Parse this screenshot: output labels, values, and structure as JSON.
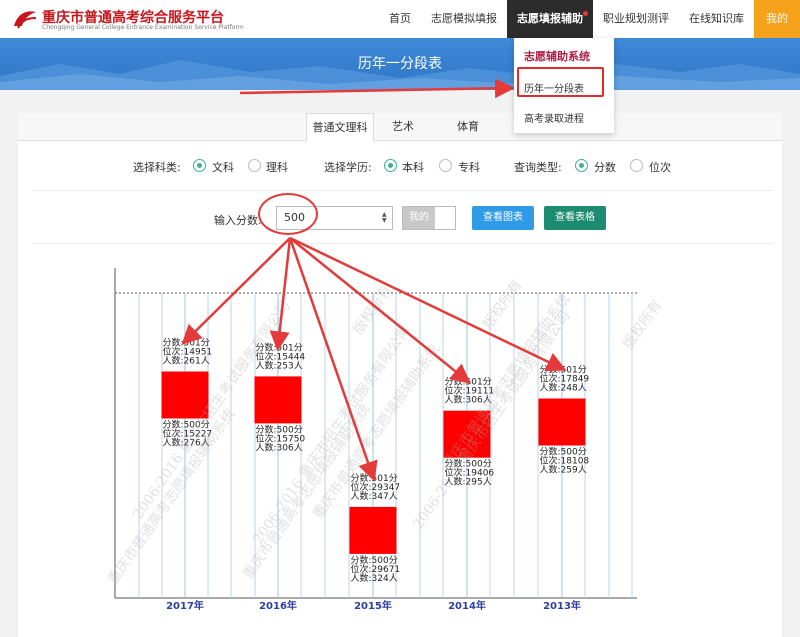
{
  "header": {
    "site_title": "重庆市普通高考综合服务平台",
    "site_subtitle": "Chongqing General College Entrance Examination Service Platform",
    "nav": [
      {
        "label": "首页"
      },
      {
        "label": "志愿模拟填报"
      },
      {
        "label": "志愿填报辅助",
        "active": true
      },
      {
        "label": "职业规划测评"
      },
      {
        "label": "在线知识库"
      },
      {
        "label": "我的"
      }
    ]
  },
  "banner": {
    "title": "历年一分段表"
  },
  "dropdown": {
    "header": "志愿辅助系统",
    "items": [
      {
        "label": "历年一分段表",
        "highlighted": true
      },
      {
        "label": "高考录取进程"
      }
    ]
  },
  "tabs": [
    {
      "label": "普通文理科",
      "active": true
    },
    {
      "label": "艺术"
    },
    {
      "label": "体育"
    }
  ],
  "filters": {
    "subject": {
      "label": "选择科类:",
      "options": [
        "文科",
        "理科"
      ],
      "selected": "文科"
    },
    "education": {
      "label": "选择学历:",
      "options": [
        "本科",
        "专科"
      ],
      "selected": "本科"
    },
    "query_type": {
      "label": "查询类型:",
      "options": [
        "分数",
        "位次"
      ],
      "selected": "分数"
    }
  },
  "score_input": {
    "label": "输入分数:",
    "value": "500"
  },
  "mine_toggle": {
    "label": "我的"
  },
  "buttons": {
    "view_chart": "查看图表",
    "view_table": "查看表格"
  },
  "chart_data": {
    "type": "bar",
    "categories": [
      "2017年",
      "2016年",
      "2015年",
      "2014年",
      "2013年"
    ],
    "upper": [
      {
        "score": "分数:501分",
        "rank": "位次:14951",
        "count": "人数:261人"
      },
      {
        "score": "分数:501分",
        "rank": "位次:15444",
        "count": "人数:253人"
      },
      {
        "score": "分数:501分",
        "rank": "位次:29347",
        "count": "人数:347人"
      },
      {
        "score": "分数:501分",
        "rank": "位次:19111",
        "count": "人数:306人"
      },
      {
        "score": "分数:501分",
        "rank": "位次:17849",
        "count": "人数:248人"
      }
    ],
    "lower": [
      {
        "score": "分数:500分",
        "rank": "位次:15227",
        "count": "人数:276人"
      },
      {
        "score": "分数:500分",
        "rank": "位次:15750",
        "count": "人数:306人"
      },
      {
        "score": "分数:500分",
        "rank": "位次:29671",
        "count": "人数:324人"
      },
      {
        "score": "分数:500分",
        "rank": "位次:19406",
        "count": "人数:295人"
      },
      {
        "score": "分数:500分",
        "rank": "位次:18108",
        "count": "人数:259人"
      }
    ],
    "rank_500": [
      15227,
      15750,
      29671,
      19406,
      18108
    ],
    "bar_color": "#ff0000",
    "category_label_color": "#2c3e9e",
    "watermarks": [
      "重庆市普通高考志愿填报辅助系统",
      "2006-2016 重庆市招生考试服务有限公司",
      "版权所有"
    ]
  },
  "colors": {
    "accent_green": "#3db38f",
    "button_blue": "#2f9be7",
    "button_green": "#1c8b70",
    "nav_active": "#2c2c2c",
    "nav_mine": "#f7a21b",
    "annotation_red": "#e32b2b"
  }
}
